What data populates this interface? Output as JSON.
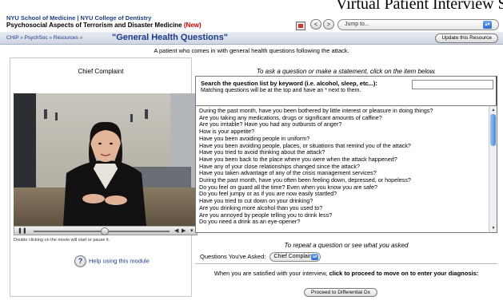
{
  "page_heading": "Virtual Patient Interview S",
  "header": {
    "org_name": "NYU School of Medicine | NYU College of Dentistry",
    "course_title": "Psychosocial Aspects of Terrorism and Disaster Medicine",
    "new_badge": "(New)",
    "back_symbol": "<",
    "forward_symbol": ">",
    "jump_to": "Jump to..."
  },
  "breadcrumb": {
    "items": [
      "CHIP",
      "PsychSoc",
      "Resources"
    ],
    "separator": "»",
    "current": "\"General Health Questions\"",
    "update_button": "Update this Resource"
  },
  "description": "A patient who comes in with general health questions following the attack.",
  "left": {
    "chief_complaint": "Chief Complaint",
    "movie_hint": "Double clicking on the movie will start or pause it.",
    "help_link": "Help using this module",
    "help_symbol": "?"
  },
  "right": {
    "instruction": "To ask a question or make a statement, click on the item below.",
    "search_label": "Search the question list by keyword (i.e. alcohol, sleep, etc...):",
    "search_sub": "Matching questions will be at the top and have an * next to them.",
    "search_value": "",
    "questions": [
      "During the past month, have you been bothered by little interest or pleasure in doing things?",
      "Are you taking any medications, drugs or significant amounts of caffine?",
      "Are you irritable? Have you had any outbursts of anger?",
      "How is your appetite?",
      "Have you been avoiding people in uniform?",
      "Have you been avoiding people, places, or situations that remind you of the attack?",
      "Have you tried to avoid thinking about the attack?",
      "Have you been back to the place where you were when the attack happened?",
      "Have any of your close relationships changed since the attack?",
      "Have you taken advantage of any of the crisis management services?",
      "During the past month, have you often been feeling down, depressed, or hopeless?",
      "Do you feel on guard all the time? Even when you know you are safe?",
      "Do you feel jumpy or as if you are now easily startled?",
      "Have you tried to cut down on your drinking?",
      "Are you drinking more alcohol than you used to?",
      "Are you annoyed by people telling you to drink less?",
      "Do you need a drink as an eye-opener?"
    ],
    "repeat_note": "To repeat a question or see what you asked",
    "asked_label": "Questions You've Asked:",
    "asked_value": "Chief Complaint",
    "proceed_text_prefix": "When you are satisfied with your interview, ",
    "proceed_text_bold": "click to proceed to move on to enter your diagnosis:",
    "proceed_button": "Proceed to Differential Dx"
  }
}
